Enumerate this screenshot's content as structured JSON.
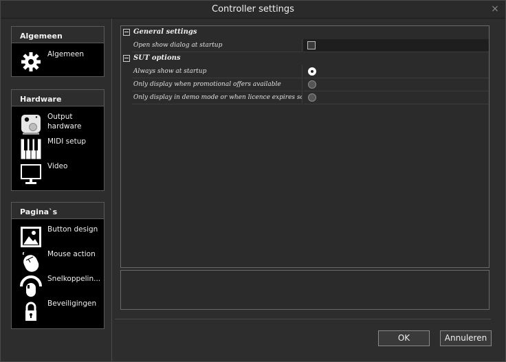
{
  "window": {
    "title": "Controller settings",
    "close_glyph": "×"
  },
  "sidebar": {
    "groups": [
      {
        "header": "Algemeen",
        "items": [
          {
            "label": "Algemeen",
            "icon": "gear-icon"
          }
        ]
      },
      {
        "header": "Hardware",
        "items": [
          {
            "label": "Output hardware",
            "icon": "speaker-icon"
          },
          {
            "label": "MIDI setup",
            "icon": "piano-keys-icon"
          },
          {
            "label": "Video",
            "icon": "monitor-icon"
          }
        ]
      },
      {
        "header": "Pagina`s",
        "items": [
          {
            "label": "Button design",
            "icon": "picture-icon"
          },
          {
            "label": "Mouse action",
            "icon": "mouse-icon"
          },
          {
            "label": "Snelkoppelin...",
            "icon": "shortcut-icon"
          },
          {
            "label": "Beveiligingen",
            "icon": "lock-icon"
          }
        ]
      }
    ]
  },
  "properties": {
    "categories": [
      {
        "label": "General settings",
        "rows": [
          {
            "name": "Open show dialog at startup",
            "control": "checkbox",
            "checked": false
          }
        ]
      },
      {
        "label": "SUT options",
        "rows": [
          {
            "name": "Always show at startup",
            "control": "radio",
            "checked": true
          },
          {
            "name": "Only display when promotional offers available",
            "control": "radio",
            "checked": false
          },
          {
            "name": "Only display in demo mode or when licence expires soon",
            "control": "radio",
            "checked": false
          }
        ]
      }
    ]
  },
  "buttons": {
    "ok": "OK",
    "cancel": "Annuleren"
  },
  "colors": {
    "background": "#2d2d2d",
    "panel": "#000000",
    "border": "#5a5a5a",
    "text": "#f0f0f0"
  }
}
